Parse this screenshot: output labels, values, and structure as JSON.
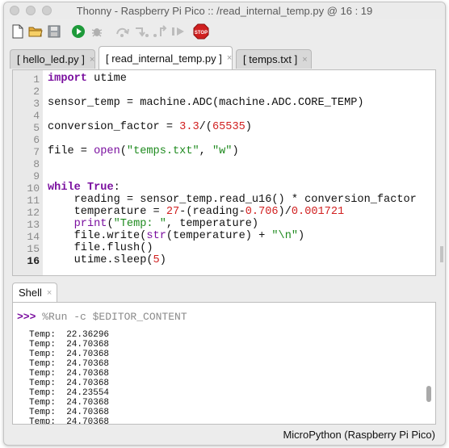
{
  "window": {
    "title": "Thonny  -  Raspberry Pi Pico :: /read_internal_temp.py  @  16 : 19"
  },
  "toolbar": {
    "buttons": [
      {
        "name": "new-file",
        "icon": "new-file-icon"
      },
      {
        "name": "open-file",
        "icon": "folder-icon"
      },
      {
        "name": "save-file",
        "icon": "floppy-icon"
      },
      {
        "name": "run",
        "icon": "run-icon"
      },
      {
        "name": "debug",
        "icon": "bug-icon"
      },
      {
        "name": "step-over",
        "icon": "step-over-icon"
      },
      {
        "name": "step-into",
        "icon": "step-into-icon"
      },
      {
        "name": "step-out",
        "icon": "step-out-icon"
      },
      {
        "name": "resume",
        "icon": "resume-icon"
      },
      {
        "name": "stop",
        "icon": "stop-icon",
        "label": "STOP"
      }
    ]
  },
  "tabs": [
    {
      "label": "[ hello_led.py ]",
      "close": "×",
      "active": false
    },
    {
      "label": "[ read_internal_temp.py ]",
      "close": "×",
      "active": true
    },
    {
      "label": "[ temps.txt ]",
      "close": "×",
      "active": false
    }
  ],
  "editor": {
    "line_numbers": [
      "1",
      "2",
      "3",
      "4",
      "5",
      "6",
      "7",
      "8",
      "9",
      "10",
      "11",
      "12",
      "13",
      "14",
      "15",
      "16"
    ],
    "current_line": "16",
    "code": {
      "l1_kw": "import",
      "l1_rest": " utime",
      "l3": "sensor_temp = machine.ADC(machine.ADC.CORE_TEMP)",
      "l5_a": "conversion_factor = ",
      "l5_n1": "3.3",
      "l5_b": "/(",
      "l5_n2": "65535",
      "l5_c": ")",
      "l7_a": "file = ",
      "l7_f": "open",
      "l7_b": "(",
      "l7_s1": "\"temps.txt\"",
      "l7_c": ", ",
      "l7_s2": "\"w\"",
      "l7_d": ")",
      "l10_kw": "while",
      "l10_sp": " ",
      "l10_t": "True",
      "l10_r": ":",
      "l11": "    reading = sensor_temp.read_u16() * conversion_factor",
      "l12_a": "    temperature = ",
      "l12_n1": "27",
      "l12_b": "-(reading-",
      "l12_n2": "0.706",
      "l12_c": ")/",
      "l12_n3": "0.001721",
      "l13_a": "    ",
      "l13_f": "print",
      "l13_b": "(",
      "l13_s": "\"Temp: \"",
      "l13_c": ", temperature)",
      "l14_a": "    file.write(",
      "l14_f": "str",
      "l14_b": "(temperature) + ",
      "l14_s": "\"\\n\"",
      "l14_c": ")",
      "l15": "    file.flush()",
      "l16_a": "    utime.sleep(",
      "l16_n": "5",
      "l16_b": ")"
    }
  },
  "shell": {
    "tab_label": "Shell",
    "tab_close": "×",
    "prompt": ">>>",
    "command": " %Run -c $EDITOR_CONTENT",
    "output": [
      "Temp:  22.36296",
      "Temp:  24.70368",
      "Temp:  24.70368",
      "Temp:  24.70368",
      "Temp:  24.70368",
      "Temp:  24.70368",
      "Temp:  24.23554",
      "Temp:  24.70368",
      "Temp:  24.70368",
      "Temp:  24.70368"
    ]
  },
  "status": {
    "interpreter": "MicroPython (Raspberry Pi Pico)"
  },
  "colors": {
    "keyword": "#7a0f9f",
    "number": "#d12020",
    "string": "#1e8a1e",
    "stop": "#d02020",
    "run": "#1e9a3a"
  }
}
